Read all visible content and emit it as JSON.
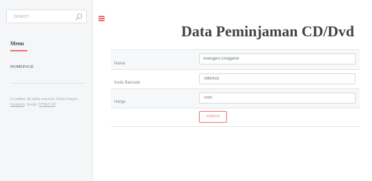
{
  "sidebar": {
    "search_placeholder": "Search",
    "menu_title": "Menu",
    "nav": [
      {
        "label": "HOMEPAGE"
      }
    ],
    "footer": {
      "prefix": "© Untitled. All rights reserved. Demo Images: ",
      "images_link": "Unsplash",
      "design_prefix": ". Design: ",
      "design_link": "HTML5 UP",
      "suffix": "."
    }
  },
  "main": {
    "title": "Data Peminjaman CD/Dvd",
    "form": {
      "rows": [
        {
          "label": "Nama",
          "value": "Avengers Endgame"
        },
        {
          "label": "Kode Barcode",
          "value": "7865433"
        },
        {
          "label": "Harga",
          "value": "7000"
        }
      ],
      "submit_label": "SIMPAN"
    }
  },
  "colors": {
    "accent": "#f56a6a",
    "heading": "#3d4449",
    "sidebar_bg": "#f5f6f7"
  },
  "icons": {
    "search": "search-icon",
    "menu": "hamburger-menu-icon"
  }
}
